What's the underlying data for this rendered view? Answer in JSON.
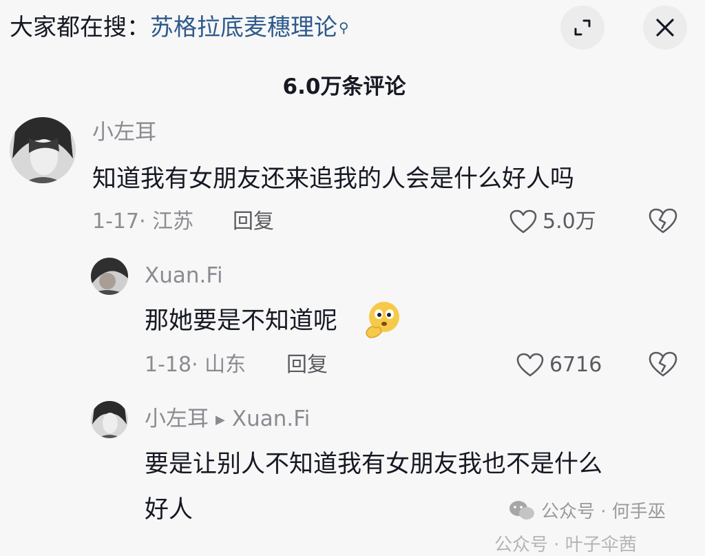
{
  "search": {
    "prefix": "大家都在搜：",
    "term": "苏格拉底麦穗理论"
  },
  "header": {
    "comment_count": "6.0万条评论"
  },
  "comments": [
    {
      "username": "小左耳",
      "text": "知道我有女朋友还来追我的人会是什么好人吗",
      "meta": "1-17· 江苏",
      "reply_label": "回复",
      "likes": "5.0万"
    }
  ],
  "replies": [
    {
      "username": "Xuan.Fi",
      "text": "那她要是不知道呢",
      "meta": "1-18· 山东",
      "reply_label": "回复",
      "likes": "6716"
    },
    {
      "username": "小左耳",
      "reply_to": "Xuan.Fi",
      "text_line1": "要是让别人不知道我有女朋友我也不是什么",
      "text_line2": "好人"
    }
  ],
  "watermark": {
    "text": "公众号 · 何手巫",
    "ghost": "公众号 · 叶子伞茜"
  },
  "icons": {
    "expand": "expand-icon",
    "close": "close-icon",
    "search": "search-icon",
    "like": "heart-icon",
    "dislike": "broken-heart-icon",
    "wechat": "wechat-icon"
  },
  "colors": {
    "link": "#2e5a8c",
    "muted": "#8a8b91",
    "text": "#161823",
    "background": "#f7f7f7"
  }
}
